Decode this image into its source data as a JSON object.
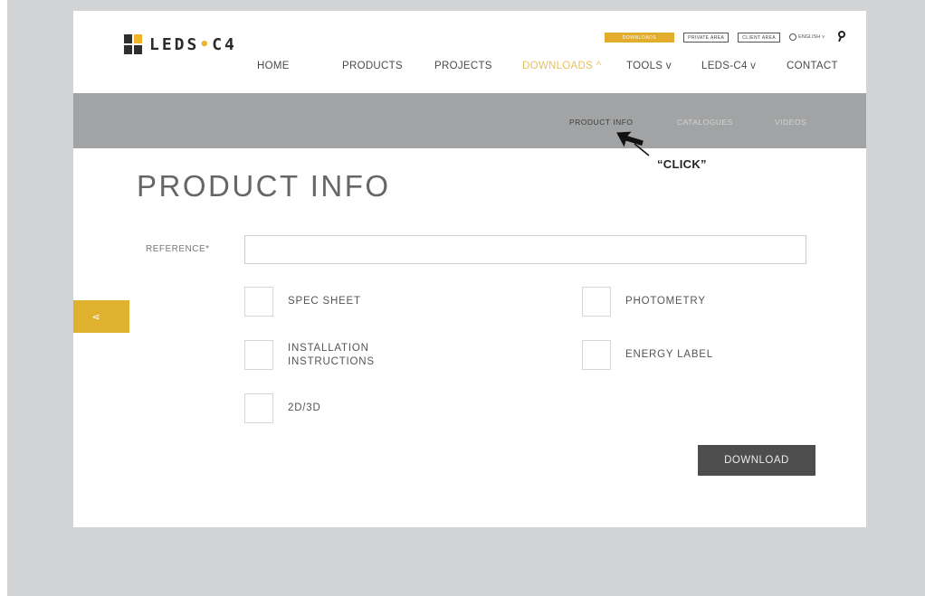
{
  "brand": {
    "name_part1": "LEDS",
    "separator": "•",
    "name_part2": "C4"
  },
  "utility": {
    "gold_button": "DOWNLOADS",
    "private_area": "PRIVATE AREA",
    "client_area": "CLIENT AREA",
    "language": "ENGLISH",
    "language_chevron": "v",
    "search_icon": "search-icon"
  },
  "nav": [
    {
      "label": "HOME"
    },
    {
      "label": "PRODUCTS"
    },
    {
      "label": "PROJECTS"
    },
    {
      "label": "DOWNLOADS ^",
      "active": true
    },
    {
      "label": "TOOLS v"
    },
    {
      "label": "LEDS-C4 v"
    },
    {
      "label": "CONTACT"
    }
  ],
  "subnav": [
    {
      "label": "PRODUCT INFO",
      "active": true
    },
    {
      "label": "CATALOGUES"
    },
    {
      "label": "VIDEOS"
    }
  ],
  "annotation": {
    "click_note": "“CLICK”"
  },
  "page": {
    "title": "PRODUCT INFO"
  },
  "form": {
    "reference_label": "REFERENCE*",
    "reference_value": "",
    "options": [
      {
        "label": "SPEC SHEET",
        "checked": false
      },
      {
        "label": "PHOTOMETRY",
        "checked": false
      },
      {
        "label": "INSTALLATION\nINSTRUCTIONS",
        "checked": false
      },
      {
        "label": "ENERGY LABEL",
        "checked": false
      },
      {
        "label": "2D/3D",
        "checked": false
      }
    ],
    "download_label": "DOWNLOAD"
  },
  "share": {
    "icon": "share-icon",
    "glyph": "⋖"
  },
  "colors": {
    "accent": "#e0b12c",
    "subbar": "#a2a3a4",
    "button_dark": "#4d4d4d",
    "background": "#d2d3d4"
  }
}
